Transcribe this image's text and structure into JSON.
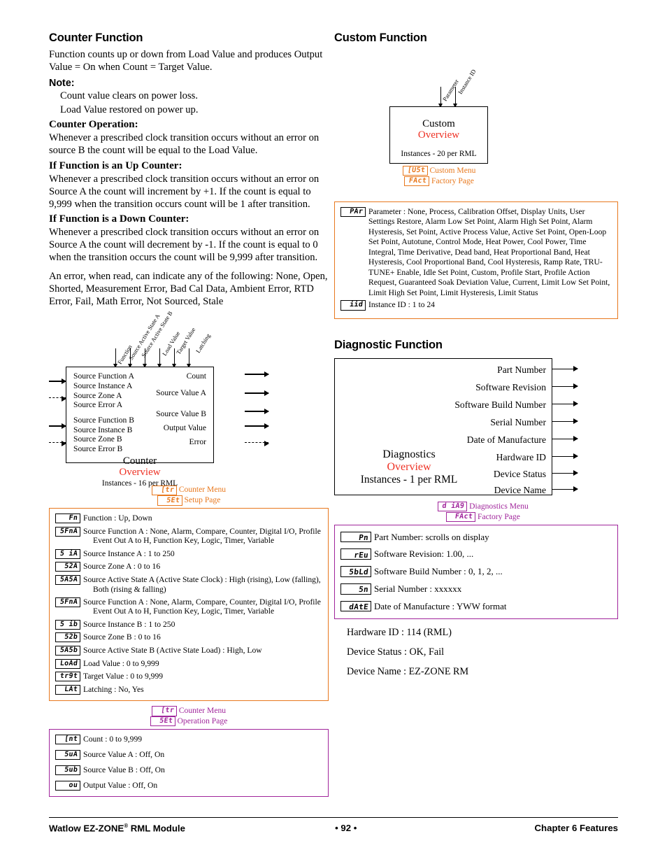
{
  "colors": {
    "accent_red": "#ee3124",
    "orange": "#e8781d",
    "purple": "#a0249b",
    "text": "#000000"
  },
  "left_column": {
    "heading": "Counter Function",
    "intro": "Function counts up or down from Load Value and produces Output Value = On when Count = Target Value.",
    "note_label": "Note:",
    "note_lines": [
      "Count value clears on power loss.",
      "Load Value restored on power up."
    ],
    "counter_operation_label": "Counter Operation:",
    "counter_operation_text": "Whenever a prescribed clock transition occurs without an error on source B the count will be equal to the Load Value.",
    "up_counter_label": "If Function is an Up Counter:",
    "up_counter_text": "Whenever a prescribed clock transition occurs without an error on Source A the count will increment by +1. If the count is equal to 9,999 when the transition occurs count will be 1 after transition.",
    "down_counter_label": "If Function is a Down Counter:",
    "down_counter_text": "Whenever a prescribed clock transition occurs without an error on Source A the count will decrement by -1. If the count is equal to 0 when the transition occurs the count will be 9,999 after transition.",
    "error_text": "An error, when read, can indicate any of the following: None, Open, Shorted, Measurement Error, Bad Cal Data, Ambient Error, RTD Error, Fail, Math Error, Not Sourced, Stale",
    "diagram": {
      "top_labels": [
        "Function",
        "Source Active State A",
        "Source Active State B",
        "Load Value",
        "Target Value",
        "Latching"
      ],
      "inputs_group_a": [
        "Source Function A",
        "Source Instance A",
        "Source Zone A",
        "Source Error A"
      ],
      "inputs_group_b": [
        "Source Function B",
        "Source Instance B",
        "Source Zone B",
        "Source Error B"
      ],
      "outputs": [
        "Count",
        "Source Value A",
        "Source Value B",
        "Output Value",
        "Error"
      ],
      "title": "Counter",
      "overview": "Overview",
      "instances": "Instances - 16 per RML"
    },
    "setup_menu": {
      "menu_code": "[tr",
      "menu_label": "Counter Menu",
      "page_code": "5Et",
      "page_label": "Setup Page",
      "params": [
        {
          "code": "Fn",
          "text": "Function : Up, Down",
          "cont": ""
        },
        {
          "code": "5FnA",
          "text": "Source Function A : None, Alarm, Compare, Counter, Digital I/O, Profile",
          "cont": "Event Out A to H, Function Key, Logic, Timer, Variable"
        },
        {
          "code": "5 iA",
          "text": "Source Instance A : 1 to 250",
          "cont": ""
        },
        {
          "code": "52A",
          "text": "Source Zone A : 0 to 16",
          "cont": ""
        },
        {
          "code": "5A5A",
          "text": "Source Active State A (Active State Clock) : High (rising), Low (falling),",
          "cont": "Both (rising & falling)"
        },
        {
          "code": "5FnA",
          "text": "Source Function A : None, Alarm, Compare, Counter, Digital I/O, Profile",
          "cont": "Event Out A to H, Function Key, Logic, Timer, Variable"
        },
        {
          "code": "5 ib",
          "text": "Source Instance B : 1 to 250",
          "cont": ""
        },
        {
          "code": "52b",
          "text": "Source Zone B : 0 to 16",
          "cont": ""
        },
        {
          "code": "5A5b",
          "text": "Source Active State B (Active State Load) : High, Low",
          "cont": ""
        },
        {
          "code": "LoAd",
          "text": "Load Value : 0 to 9,999",
          "cont": ""
        },
        {
          "code": "tr9t",
          "text": "Target Value : 0 to 9,999",
          "cont": ""
        },
        {
          "code": "LAt",
          "text": "Latching : No, Yes",
          "cont": ""
        }
      ]
    },
    "operation_menu": {
      "menu_code": "[tr",
      "menu_label": "Counter Menu",
      "page_code": "5Et",
      "page_label": "Operation Page",
      "params": [
        {
          "code": "[nt",
          "text": "Count : 0 to 9,999",
          "cont": ""
        },
        {
          "code": "5uA",
          "text": "Source Value A : Off, On",
          "cont": ""
        },
        {
          "code": "5ub",
          "text": "Source Value B : Off, On",
          "cont": ""
        },
        {
          "code": "ou",
          "text": "Output Value : Off, On",
          "cont": ""
        }
      ]
    }
  },
  "right_column": {
    "custom": {
      "heading": "Custom Function",
      "top_labels": [
        "Parameter",
        "Instance ID"
      ],
      "title": "Custom",
      "overview": "Overview",
      "instances": "Instances - 20 per RML",
      "menu_code": "[U5t",
      "menu_label": "Custom Menu",
      "page_code": "FAct",
      "page_label": "Factory Page",
      "params": [
        {
          "code": "PAr",
          "text": "Parameter : None,  Process, Calibration Offset, Display Units, User Settings Restore, Alarm Low Set Point, Alarm High Set Point, Alarm Hysteresis, Set Point, Active Process Value, Active Set Point, Open-Loop Set Point, Autotune, Control Mode, Heat Power, Cool Power, Time Integral, Time Derivative, Dead band, Heat Proportional Band, Heat Hysteresis, Cool Proportional Band, Cool Hysteresis, Ramp Rate, TRU-TUNE+ Enable, Idle Set Point, Custom, Profile Start, Profile Action Request, Guaranteed Soak Deviation Value, Current, Limit Low Set Point, Limit High Set Point, Limit Hysteresis, Limit Status"
        },
        {
          "code": "iid",
          "text": "Instance ID : 1 to 24"
        }
      ]
    },
    "diagnostic": {
      "heading": "Diagnostic Function",
      "outputs": [
        "Part Number",
        "Software Revision",
        "Software Build Number",
        "Serial Number",
        "Date of Manufacture",
        "Hardware ID",
        "Device Status",
        "Device Name"
      ],
      "title": "Diagnostics",
      "overview": "Overview",
      "instances": "Instances - 1 per RML",
      "menu_code": "d iA9",
      "menu_label": "Diagnostics Menu",
      "page_code": "FAct",
      "page_label": "Factory Page",
      "params": [
        {
          "code": "Pn",
          "text": "Part Number: scrolls on display"
        },
        {
          "code": "rEu",
          "text": "Software Revision: 1.00, ..."
        },
        {
          "code": "5bLd",
          "text": "Software Build Number : 0, 1, 2, ..."
        },
        {
          "code": "5n",
          "text": "Serial Number : xxxxxx"
        },
        {
          "code": "dAtE",
          "text": "Date of Manufacture : YWW format"
        }
      ],
      "tail_lines": [
        "Hardware ID : 114 (RML)",
        "Device Status : OK, Fail",
        "Device Name : EZ-ZONE RM"
      ]
    }
  },
  "footer": {
    "left_pre": "Watlow EZ-ZONE",
    "left_sup": "®",
    "left_post": " RML Module",
    "page": "• 92 •",
    "right": "Chapter 6 Features"
  }
}
